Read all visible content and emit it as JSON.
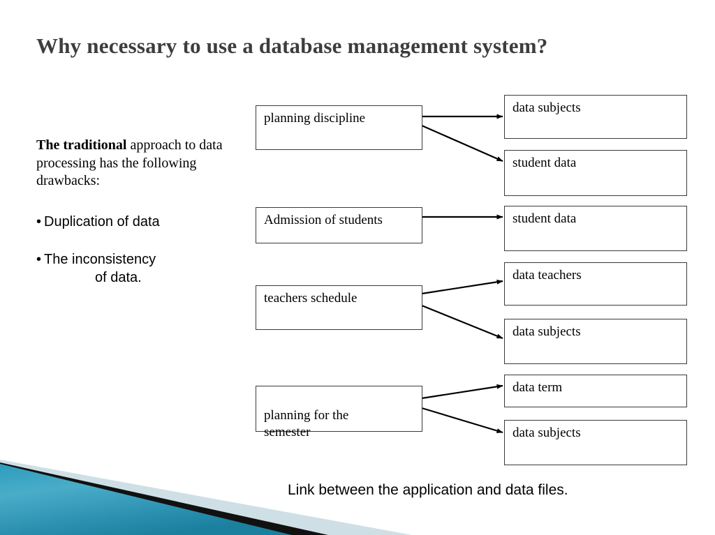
{
  "slide": {
    "title": "Why necessary to use a database management system?",
    "caption": "Link between the application and data files."
  },
  "left_column": {
    "intro_lead": "The traditional",
    "intro_rest": " approach to data processing has the following drawbacks:",
    "bullets": [
      {
        "marker": "•",
        "text": "Duplication of data",
        "wrapped": ""
      },
      {
        "marker": "•",
        "text": "The inconsistency",
        "wrapped": "of data."
      }
    ]
  },
  "diagram": {
    "applications": [
      {
        "id": "planning-discipline",
        "label": "planning discipline"
      },
      {
        "id": "admission-of-students",
        "label": "Admission of students"
      },
      {
        "id": "teachers-schedule",
        "label": "teachers schedule"
      },
      {
        "id": "planning-for-the-semester",
        "label": "planning for the\nsemester"
      }
    ],
    "data_files": [
      {
        "id": "data-subjects-1",
        "label": "data subjects"
      },
      {
        "id": "student-data-1",
        "label": "student data"
      },
      {
        "id": "student-data-2",
        "label": "student data"
      },
      {
        "id": "data-teachers",
        "label": "data teachers"
      },
      {
        "id": "data-subjects-2",
        "label": "data subjects"
      },
      {
        "id": "data-term",
        "label": "data term"
      },
      {
        "id": "data-subjects-3",
        "label": "data subjects"
      }
    ],
    "links": [
      {
        "from": "planning discipline",
        "to": "data subjects"
      },
      {
        "from": "planning discipline",
        "to": "student data"
      },
      {
        "from": "Admission of students",
        "to": "student data"
      },
      {
        "from": "teachers schedule",
        "to": "data teachers"
      },
      {
        "from": "teachers schedule",
        "to": "data subjects"
      },
      {
        "from": "planning for the semester",
        "to": "data term"
      },
      {
        "from": "planning for the semester",
        "to": "data subjects"
      }
    ]
  },
  "colors": {
    "title": "#3d3d3d",
    "box_border": "#3a3a3a",
    "arrow": "#000000",
    "decoration_teal_light": "#56b3cf",
    "decoration_teal_dark": "#1b7f9e",
    "decoration_black": "#101010",
    "decoration_pale": "#cfdfe6"
  }
}
